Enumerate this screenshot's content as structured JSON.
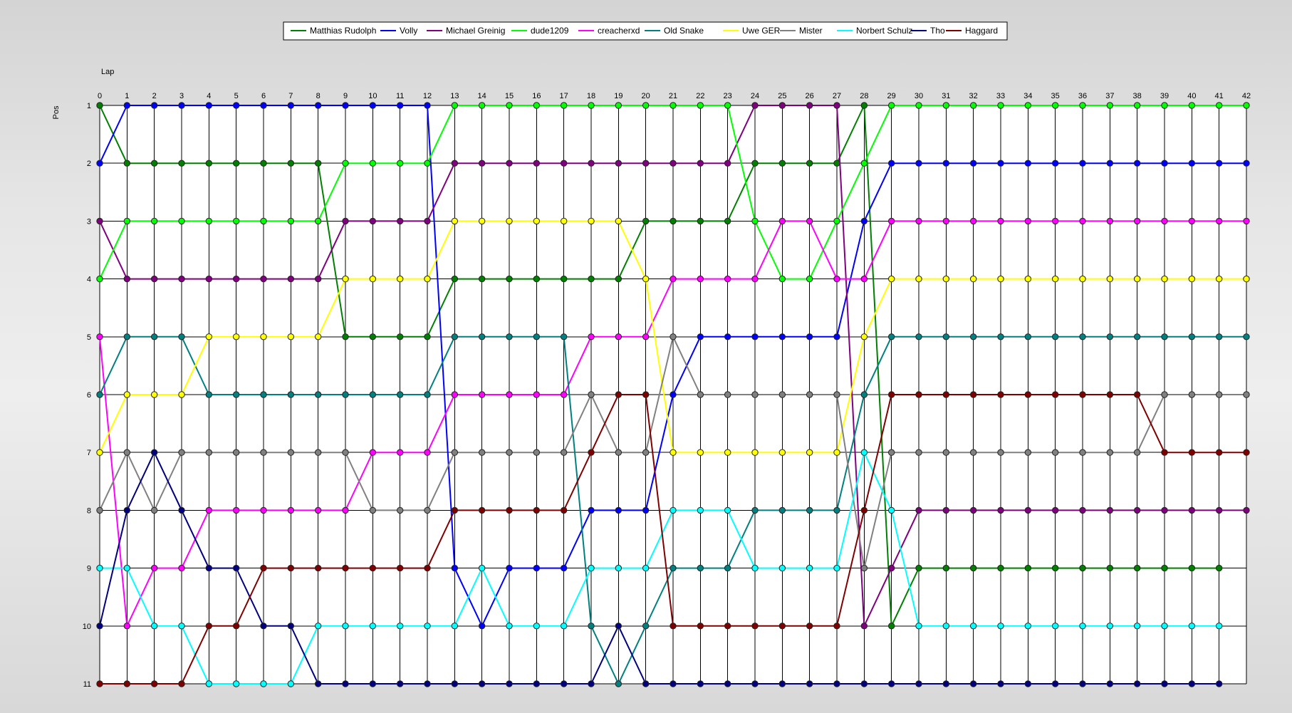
{
  "chart_data": {
    "type": "line",
    "xlabel": "Lap",
    "ylabel": "Pos",
    "x": [
      0,
      1,
      2,
      3,
      4,
      5,
      6,
      7,
      8,
      9,
      10,
      11,
      12,
      13,
      14,
      15,
      16,
      17,
      18,
      19,
      20,
      21,
      22,
      23,
      24,
      25,
      26,
      27,
      28,
      29,
      30,
      31,
      32,
      33,
      34,
      35,
      36,
      37,
      38,
      39,
      40,
      41,
      42
    ],
    "xlim": [
      0,
      42
    ],
    "ylim": [
      1,
      11
    ],
    "y_inverted": true,
    "yticks": [
      1,
      2,
      3,
      4,
      5,
      6,
      7,
      8,
      9,
      10,
      11
    ],
    "grid": true,
    "legend_position": "top-center",
    "series": [
      {
        "name": "Matthias Rudolph",
        "color": "#008000",
        "values": [
          1,
          2,
          2,
          2,
          2,
          2,
          2,
          2,
          2,
          5,
          5,
          5,
          5,
          4,
          4,
          4,
          4,
          4,
          4,
          4,
          3,
          3,
          3,
          3,
          2,
          2,
          2,
          2,
          1,
          10,
          9,
          9,
          9,
          9,
          9,
          9,
          9,
          9,
          9,
          9,
          9,
          9,
          null
        ]
      },
      {
        "name": "Volly",
        "color": "#0000ff",
        "values": [
          2,
          1,
          1,
          1,
          1,
          1,
          1,
          1,
          1,
          1,
          1,
          1,
          1,
          9,
          10,
          9,
          9,
          9,
          8,
          8,
          8,
          6,
          5,
          5,
          5,
          5,
          5,
          5,
          3,
          2,
          2,
          2,
          2,
          2,
          2,
          2,
          2,
          2,
          2,
          2,
          2,
          2,
          2
        ]
      },
      {
        "name": "Michael Greinig",
        "color": "#800080",
        "values": [
          3,
          4,
          4,
          4,
          4,
          4,
          4,
          4,
          4,
          3,
          3,
          3,
          3,
          2,
          2,
          2,
          2,
          2,
          2,
          2,
          2,
          2,
          2,
          2,
          1,
          1,
          1,
          1,
          10,
          9,
          8,
          8,
          8,
          8,
          8,
          8,
          8,
          8,
          8,
          8,
          8,
          8,
          8
        ]
      },
      {
        "name": "dude1209",
        "color": "#00ff00",
        "values": [
          4,
          3,
          3,
          3,
          3,
          3,
          3,
          3,
          3,
          2,
          2,
          2,
          2,
          1,
          1,
          1,
          1,
          1,
          1,
          1,
          1,
          1,
          1,
          1,
          3,
          4,
          4,
          3,
          2,
          1,
          1,
          1,
          1,
          1,
          1,
          1,
          1,
          1,
          1,
          1,
          1,
          1,
          1
        ]
      },
      {
        "name": "creacherxd",
        "color": "#ff00ff",
        "values": [
          5,
          10,
          9,
          9,
          8,
          8,
          8,
          8,
          8,
          8,
          7,
          7,
          7,
          6,
          6,
          6,
          6,
          6,
          5,
          5,
          5,
          4,
          4,
          4,
          4,
          3,
          3,
          4,
          4,
          3,
          3,
          3,
          3,
          3,
          3,
          3,
          3,
          3,
          3,
          3,
          3,
          3,
          3
        ]
      },
      {
        "name": "Old Snake",
        "color": "#008080",
        "values": [
          6,
          5,
          5,
          5,
          6,
          6,
          6,
          6,
          6,
          6,
          6,
          6,
          6,
          5,
          5,
          5,
          5,
          5,
          10,
          11,
          10,
          9,
          9,
          9,
          8,
          8,
          8,
          8,
          6,
          5,
          5,
          5,
          5,
          5,
          5,
          5,
          5,
          5,
          5,
          5,
          5,
          5,
          5
        ]
      },
      {
        "name": "Uwe GER",
        "color": "#ffff00",
        "values": [
          7,
          6,
          6,
          6,
          5,
          5,
          5,
          5,
          5,
          4,
          4,
          4,
          4,
          3,
          3,
          3,
          3,
          3,
          3,
          3,
          4,
          7,
          7,
          7,
          7,
          7,
          7,
          7,
          5,
          4,
          4,
          4,
          4,
          4,
          4,
          4,
          4,
          4,
          4,
          4,
          4,
          4,
          4
        ]
      },
      {
        "name": "Mister",
        "color": "#808080",
        "values": [
          8,
          7,
          8,
          7,
          7,
          7,
          7,
          7,
          7,
          7,
          8,
          8,
          8,
          7,
          7,
          7,
          7,
          7,
          6,
          7,
          7,
          5,
          6,
          6,
          6,
          6,
          6,
          6,
          9,
          7,
          7,
          7,
          7,
          7,
          7,
          7,
          7,
          7,
          7,
          6,
          6,
          6,
          6
        ]
      },
      {
        "name": "Norbert Schulz",
        "color": "#00ffff",
        "values": [
          9,
          9,
          10,
          10,
          11,
          11,
          11,
          11,
          10,
          10,
          10,
          10,
          10,
          10,
          9,
          10,
          10,
          10,
          9,
          9,
          9,
          8,
          8,
          8,
          9,
          9,
          9,
          9,
          7,
          8,
          10,
          10,
          10,
          10,
          10,
          10,
          10,
          10,
          10,
          10,
          10,
          10,
          null
        ]
      },
      {
        "name": "Tho",
        "color": "#000080",
        "values": [
          10,
          8,
          7,
          8,
          9,
          9,
          10,
          10,
          11,
          11,
          11,
          11,
          11,
          11,
          11,
          11,
          11,
          11,
          11,
          10,
          11,
          11,
          11,
          11,
          11,
          11,
          11,
          11,
          11,
          11,
          11,
          11,
          11,
          11,
          11,
          11,
          11,
          11,
          11,
          11,
          11,
          11,
          null
        ]
      },
      {
        "name": "Haggard",
        "color": "#800000",
        "values": [
          11,
          11,
          11,
          11,
          10,
          10,
          9,
          9,
          9,
          9,
          9,
          9,
          9,
          8,
          8,
          8,
          8,
          8,
          7,
          6,
          6,
          10,
          10,
          10,
          10,
          10,
          10,
          10,
          8,
          6,
          6,
          6,
          6,
          6,
          6,
          6,
          6,
          6,
          6,
          7,
          7,
          7,
          7
        ]
      }
    ]
  }
}
